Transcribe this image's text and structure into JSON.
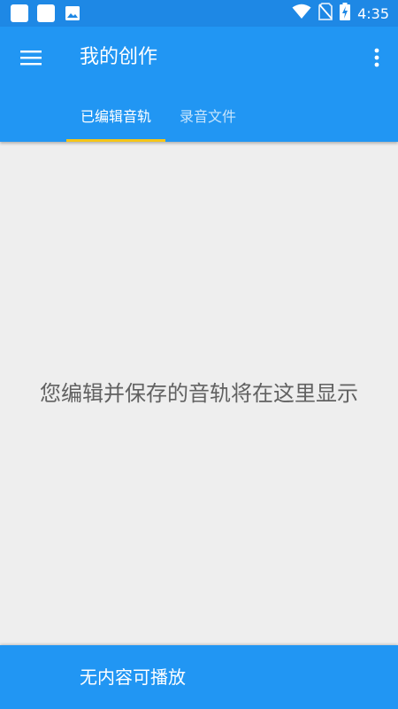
{
  "status_bar": {
    "time": "4:35",
    "icons": [
      "notification-square-icon",
      "notification-square-icon",
      "image-icon",
      "wifi-icon",
      "no-sim-icon",
      "battery-charging-icon"
    ]
  },
  "colors": {
    "appbar": "#2196f3",
    "statusbar": "#1e88e5",
    "tab_indicator": "#f5c518",
    "background": "#eeeeee"
  },
  "appbar": {
    "title": "我的创作",
    "tabs": [
      {
        "label": "已编辑音轨",
        "active": true
      },
      {
        "label": "录音文件",
        "active": false
      }
    ]
  },
  "main": {
    "empty_message": "您编辑并保存的音轨将在这里显示"
  },
  "bottom_bar": {
    "label": "无内容可播放"
  }
}
